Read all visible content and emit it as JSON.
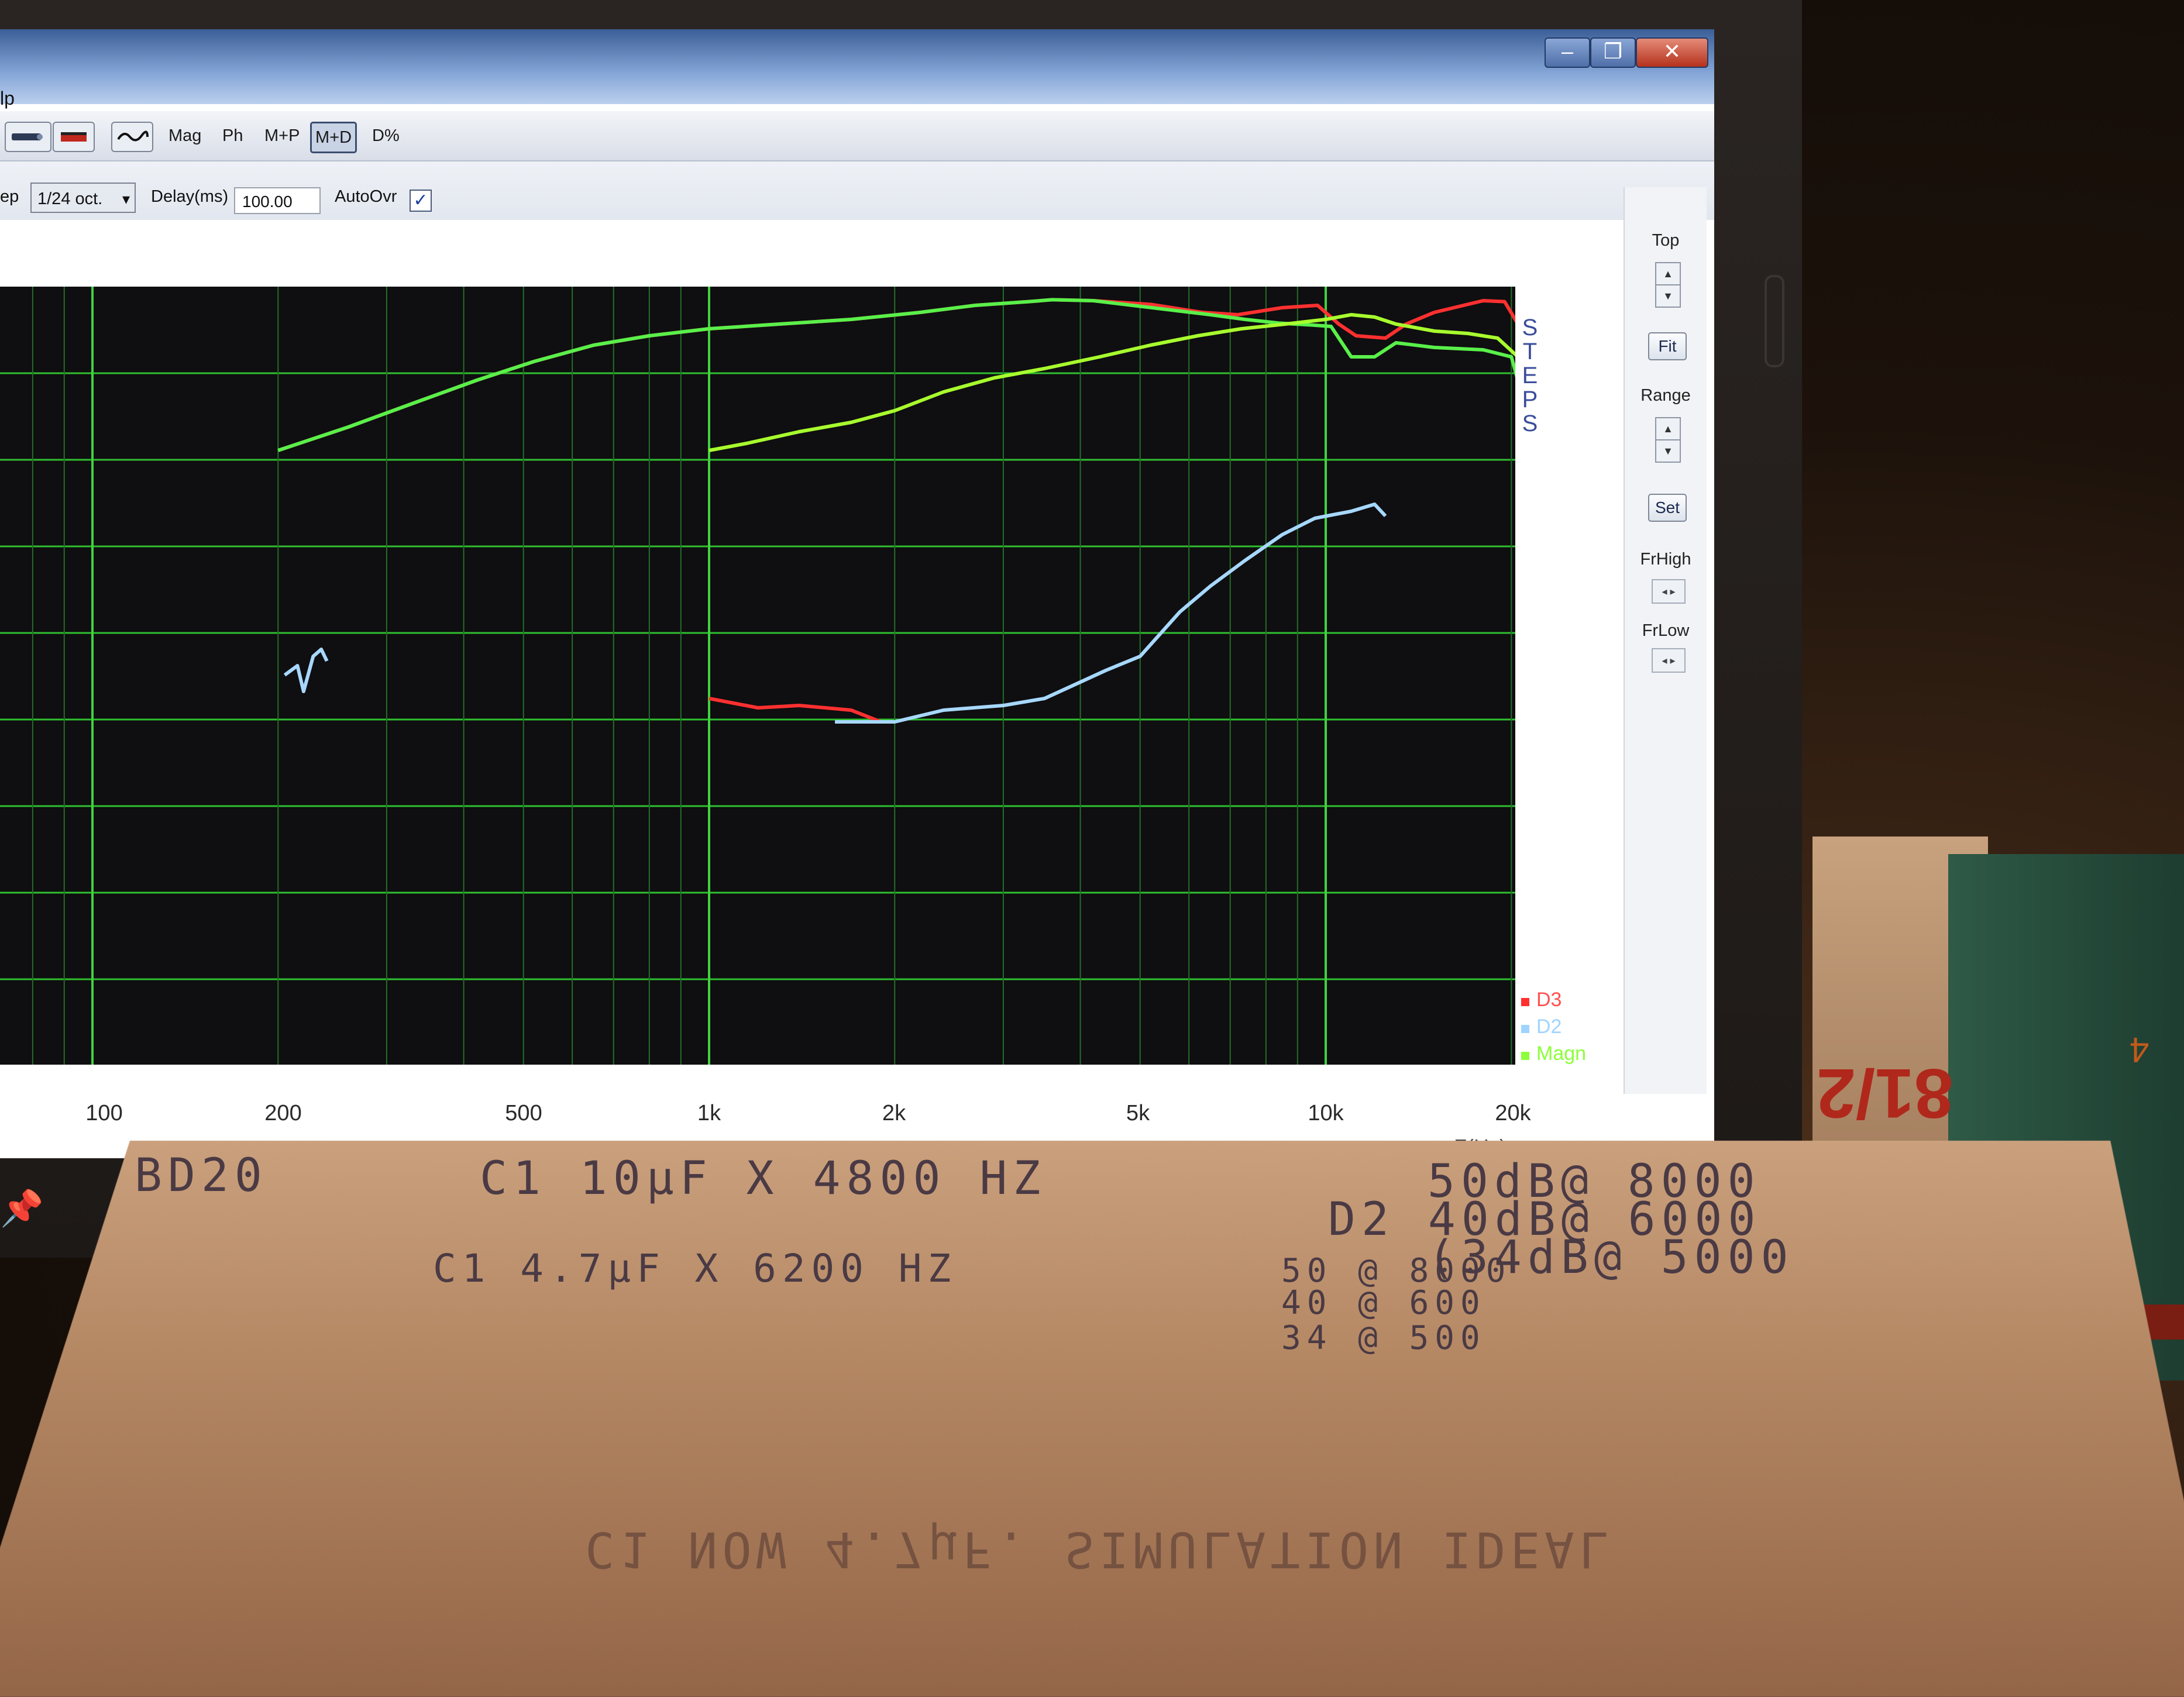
{
  "app": {
    "title_fragment": "lp",
    "window_buttons": [
      "–",
      "❐",
      "✕"
    ]
  },
  "toolbar": {
    "buttons": [
      "Mag",
      "Ph",
      "M+P",
      "M+D",
      "D%"
    ],
    "active": "M+D"
  },
  "controls": {
    "step_label": "ep",
    "step_value": "1/24 oct.",
    "delay_label": "Delay(ms)",
    "delay_value": "100.00",
    "autoovr_label": "AutoOvr",
    "autoovr_checked": true
  },
  "side_panel": {
    "top_label": "Top",
    "fit_label": "Fit",
    "range_label": "Range",
    "set_label": "Set",
    "frhigh_label": "FrHigh",
    "frlow_label": "FrLow"
  },
  "plot": {
    "steps_label": "S\nT\nE\nP\nS",
    "legend": [
      {
        "name": "D3",
        "color": "#ff3030"
      },
      {
        "name": "D2",
        "color": "#9fd4ff"
      },
      {
        "name": "Magn",
        "color": "#8cff3a"
      }
    ],
    "x_ticks": [
      "100",
      "200",
      "500",
      "1k",
      "2k",
      "5k",
      "10k",
      "20k"
    ],
    "x_unit": "F(Hz)",
    "background": "#0f0e10",
    "grid_color": "#2fbf2f"
  },
  "note": {
    "lines": [
      "BD20",
      "C1   10μF  X 4800 HZ",
      "50dB@ 8000",
      "D2 40dB@ 6000",
      "(34dB@ 5000",
      "C1   4.7μF  X  6200 HZ",
      "50 @ 8000",
      "40 @ 600",
      "34 @ 500"
    ],
    "bottom_mirrored": "C1 NOW 4.7μF. SIMULATION IDEAL"
  },
  "box": {
    "print_text": "81/2",
    "small_print": "4"
  }
}
